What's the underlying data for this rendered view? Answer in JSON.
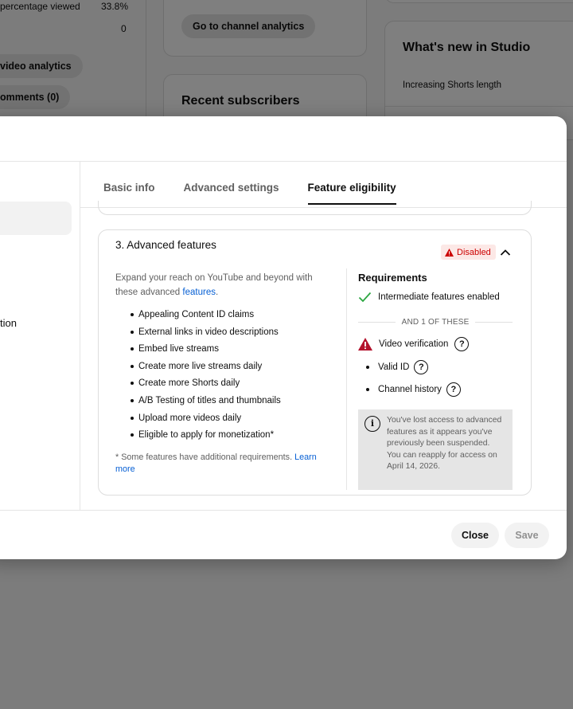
{
  "background": {
    "stats": {
      "percentage_label": "percentage viewed",
      "percentage_value": "33.8%",
      "count_value": "0"
    },
    "video_analytics_btn": "video analytics",
    "comments_btn": "omments (0)",
    "channel_analytics_btn": "Go to channel analytics",
    "recent_subscribers_title": "Recent subscribers",
    "whats_new_title": "What's new in Studio",
    "whats_new_item": "Increasing Shorts length"
  },
  "dialog": {
    "sidebar_partial_text": "tion",
    "tabs": [
      {
        "label": "Basic info"
      },
      {
        "label": "Advanced settings"
      },
      {
        "label": "Feature eligibility"
      }
    ],
    "active_tab": "Feature eligibility",
    "card": {
      "title": "3. Advanced features",
      "status_badge": "Disabled",
      "description_prefix": "Expand your reach on YouTube and beyond with these advanced ",
      "description_link": "features",
      "description_suffix": ".",
      "features": [
        "Appealing Content ID claims",
        "External links in video descriptions",
        "Embed live streams",
        "Create more live streams daily",
        "Create more Shorts daily",
        "A/B Testing of titles and thumbnails",
        "Upload more videos daily",
        "Eligible to apply for monetization*"
      ],
      "footnote_text": "* Some features have additional requirements. ",
      "footnote_link": "Learn more",
      "requirements": {
        "title": "Requirements",
        "met": "Intermediate features enabled",
        "and_one_of": "AND 1 OF THESE",
        "video_verification": "Video verification",
        "valid_id": "Valid ID",
        "channel_history": "Channel history",
        "notice": "You've lost access to advanced features as it appears you've previously been suspended. You can reapply for access on April 14, 2026."
      }
    },
    "footer": {
      "close_label": "Close",
      "save_label": "Save"
    }
  },
  "colors": {
    "link": "#065fd4",
    "disabled_red": "#cc0000",
    "check_green": "#2ba640",
    "warning_red": "#b3122d"
  }
}
